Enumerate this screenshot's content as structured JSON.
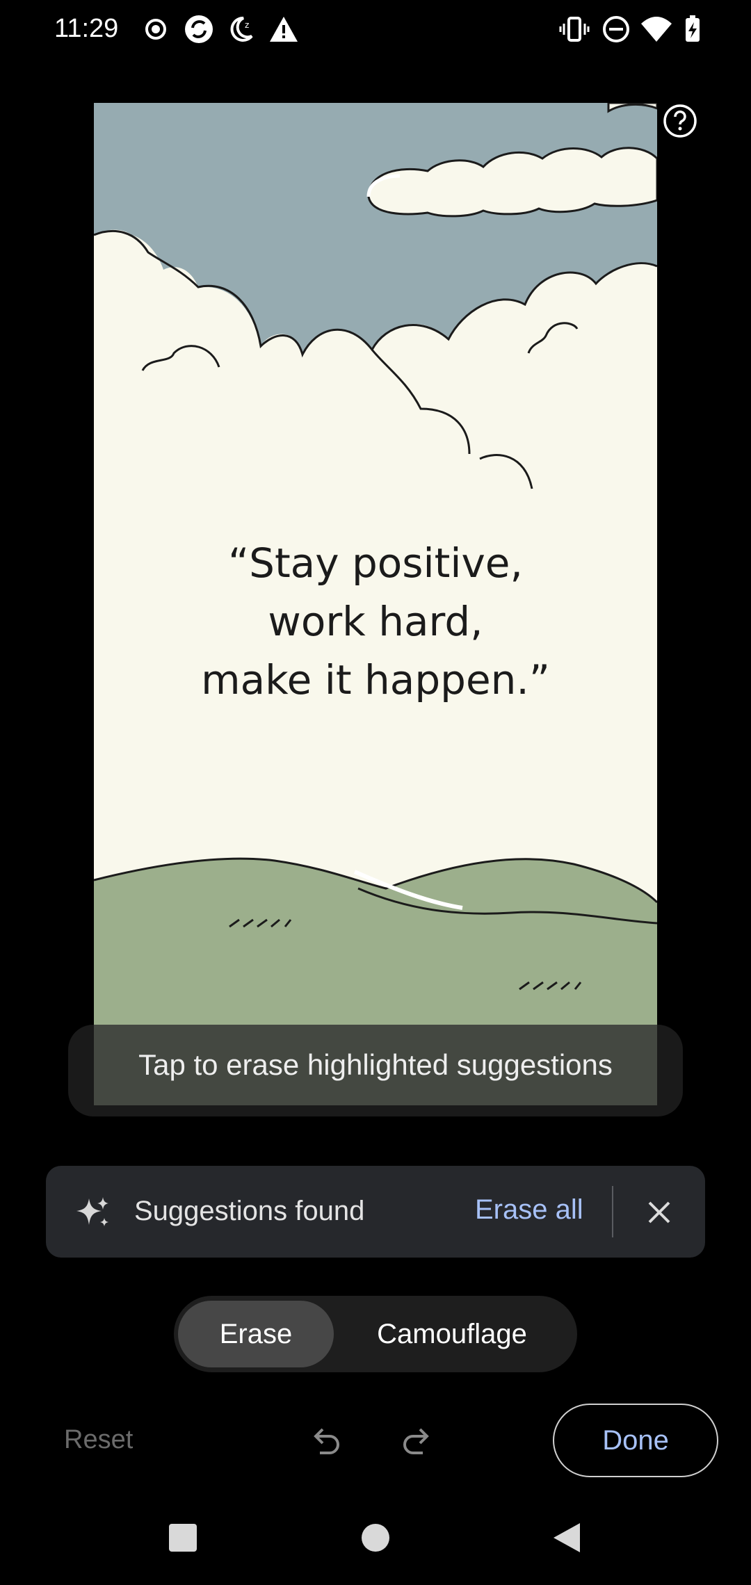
{
  "status_bar": {
    "time": "11:29",
    "left_icons": [
      "record-icon",
      "sync-icon",
      "night-mode-icon",
      "warning-icon"
    ],
    "right_icons": [
      "vibrate-icon",
      "do-not-disturb-icon",
      "wifi-icon",
      "battery-charging-icon"
    ]
  },
  "image": {
    "quote_lines": [
      "“Stay positive,",
      "work hard,",
      "make it happen.”"
    ],
    "colors": {
      "sky": "#96abb1",
      "cloud": "#f9f8ec",
      "hill": "#9caf8c"
    }
  },
  "toast": {
    "text": "Tap to erase highlighted suggestions"
  },
  "suggestions": {
    "icon": "sparkle-icon",
    "text": "Suggestions found",
    "erase_all_label": "Erase all",
    "close_icon": "close-icon"
  },
  "mode_switch": {
    "erase_label": "Erase",
    "camouflage_label": "Camouflage",
    "selected": "Erase"
  },
  "bottom_bar": {
    "reset_label": "Reset",
    "done_label": "Done"
  },
  "colors": {
    "accent": "#a7c1f7",
    "background": "#000000",
    "panel": "#26282c"
  },
  "nav_bar": {
    "icons": [
      "recents-icon",
      "home-icon",
      "back-icon"
    ]
  }
}
